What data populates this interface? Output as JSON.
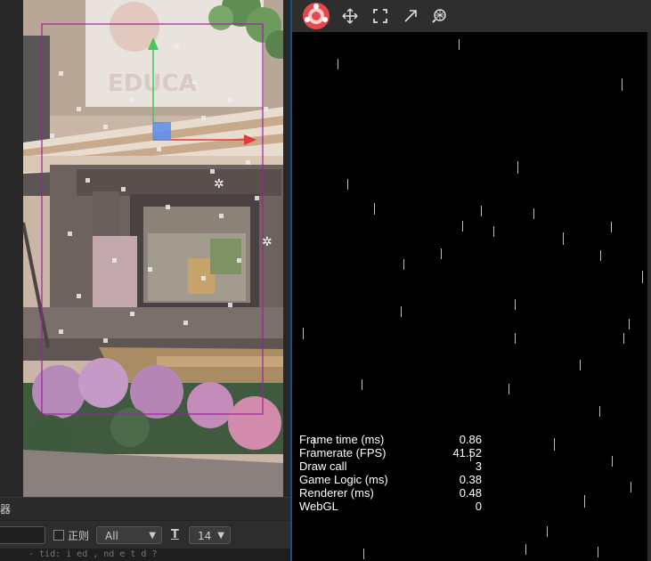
{
  "scene_panel": {
    "sign_text": "EDUCA"
  },
  "console": {
    "tab_label": "器",
    "search_value": "",
    "regex_label": "正则",
    "level_value": "All",
    "font_size_value": "14",
    "log_line": "- tid: i  ed   ,  nd  e   t  d  ?"
  },
  "game_panel": {
    "tools": [
      "logo-icon",
      "move-icon",
      "rect-icon",
      "scale-icon",
      "globe-icon"
    ],
    "stats": [
      {
        "label": "Frame time (ms)",
        "value": "0.86"
      },
      {
        "label": "Framerate (FPS)",
        "value": "41.52"
      },
      {
        "label": "Draw call",
        "value": "3"
      },
      {
        "label": "Game Logic (ms)",
        "value": "0.38"
      },
      {
        "label": "Renderer (ms)",
        "value": "0.48"
      },
      {
        "label": "WebGL",
        "value": "0"
      }
    ]
  },
  "colors": {
    "selection": "#a020a0",
    "gizmo_x": "#e53935",
    "gizmo_y": "#43c65a",
    "gizmo_center": "#5b8dee",
    "panel_border": "#1a4f8a"
  }
}
